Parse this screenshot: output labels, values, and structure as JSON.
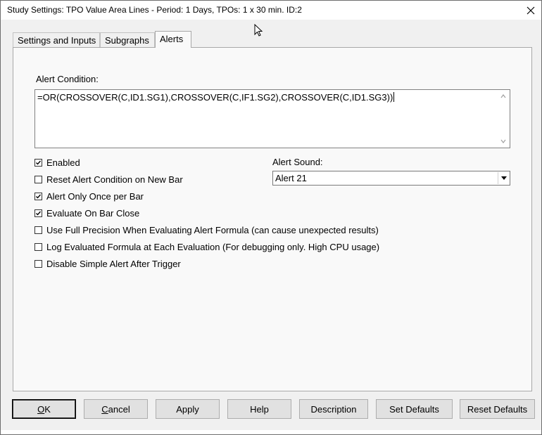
{
  "window": {
    "title": "Study Settings: TPO Value Area Lines - Period: 1 Days, TPOs: 1 x 30 min. ID:2",
    "close_glyph": "✕"
  },
  "tabs": [
    {
      "label": "Settings and Inputs",
      "active": false
    },
    {
      "label": "Subgraphs",
      "active": false
    },
    {
      "label": "Alerts",
      "active": true
    }
  ],
  "alert_condition": {
    "label": "Alert Condition:",
    "formula": "=OR(CROSSOVER(C,ID1.SG1),CROSSOVER(C,IF1.SG2),CROSSOVER(C,ID1.SG3))"
  },
  "options": [
    {
      "label": "Enabled",
      "checked": true
    },
    {
      "label": "Reset Alert Condition on New Bar",
      "checked": false
    },
    {
      "label": "Alert Only Once per Bar",
      "checked": true
    },
    {
      "label": "Evaluate On Bar Close",
      "checked": true
    },
    {
      "label": "Use Full Precision When Evaluating Alert Formula (can cause unexpected results)",
      "checked": false
    },
    {
      "label": "Log Evaluated Formula at Each Evaluation (For debugging only. High CPU usage)",
      "checked": false
    },
    {
      "label": "Disable Simple Alert After Trigger",
      "checked": false
    }
  ],
  "alert_sound": {
    "label": "Alert Sound:",
    "value": "Alert 21"
  },
  "buttons": {
    "ok_prefix": "",
    "ok_mnemonic": "O",
    "ok_rest": "K",
    "cancel_mnemonic": "C",
    "cancel_rest": "ancel",
    "apply": "Apply",
    "help": "Help",
    "description": "Description",
    "set_defaults": "Set Defaults",
    "reset_defaults": "Reset Defaults"
  }
}
